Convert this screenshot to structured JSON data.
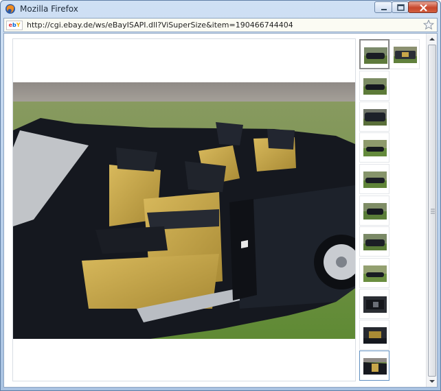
{
  "window": {
    "title": "Mozilla Firefox",
    "icons": {
      "app": "firefox-icon",
      "minimize": "minimize-icon",
      "maximize": "maximize-icon",
      "close": "close-icon"
    }
  },
  "address_bar": {
    "favicon_text": [
      "e",
      "b",
      "Y"
    ],
    "url": "http://cgi.ebay.de/ws/eBayISAPI.dll?ViSuperSize&item=190466744404",
    "bookmark_icon": "star-icon"
  },
  "gallery": {
    "main_image": "car-interior-photo",
    "thumbnails": [
      "thumbnail-1",
      "thumbnail-2",
      "thumbnail-3",
      "thumbnail-4",
      "thumbnail-5",
      "thumbnail-6",
      "thumbnail-7",
      "thumbnail-8",
      "thumbnail-9",
      "thumbnail-10",
      "thumbnail-11",
      "thumbnail-12"
    ],
    "selected_index": 12
  },
  "colors": {
    "accent": "#5f8fc0",
    "ebay_red": "#e53238",
    "ebay_blue": "#0064d2",
    "ebay_yellow": "#f5af02",
    "car_body": "#161a22",
    "seat_yellow": "#c8a64a",
    "grass": "#6a8a3c"
  }
}
